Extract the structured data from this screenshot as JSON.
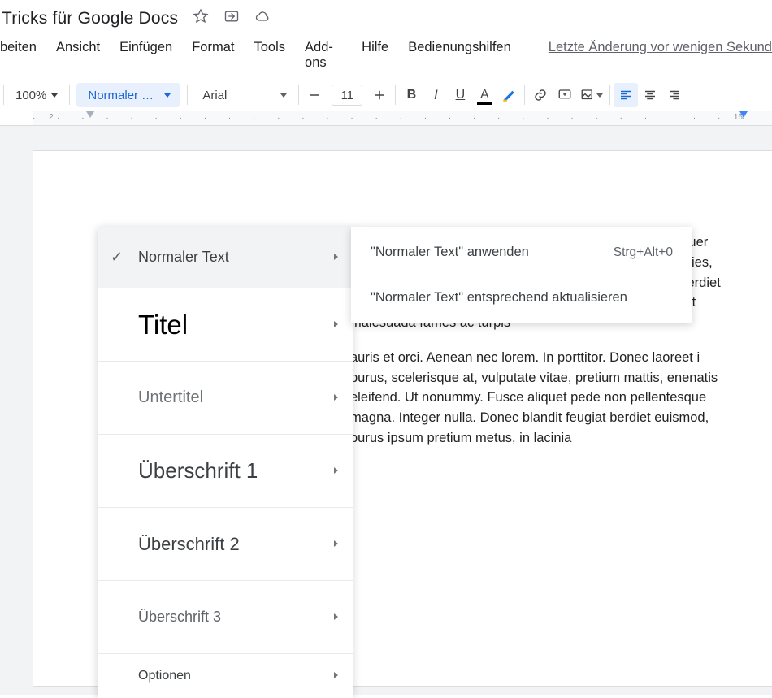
{
  "titlebar": {
    "doc_title": "Tricks für Google Docs"
  },
  "menubar": {
    "items": [
      "beiten",
      "Ansicht",
      "Einfügen",
      "Format",
      "Tools",
      "Add-ons",
      "Hilfe",
      "Bedienungshilfen"
    ],
    "last_change": "Letzte Änderung vor wenigen Sekund"
  },
  "toolbar": {
    "zoom": "100%",
    "style_label": "Normaler T...",
    "font_label": "Arial",
    "font_size": "11"
  },
  "ruler": {
    "num_left": "2",
    "num_right": "16"
  },
  "style_menu": {
    "items": [
      {
        "label": "Normaler Text",
        "checked": true,
        "cls": "smi-normal",
        "highlight": true,
        "height": "small"
      },
      {
        "label": "Titel",
        "checked": false,
        "cls": "smi-titel"
      },
      {
        "label": "Untertitel",
        "checked": false,
        "cls": "smi-untertitel"
      },
      {
        "label": "Überschrift 1",
        "checked": false,
        "cls": "smi-h1"
      },
      {
        "label": "Überschrift 2",
        "checked": false,
        "cls": "smi-h2"
      },
      {
        "label": "Überschrift 3",
        "checked": false,
        "cls": "smi-h3"
      },
      {
        "label": "Optionen",
        "checked": false,
        "cls": "smi-options",
        "options": true
      }
    ]
  },
  "sub_menu": {
    "apply_label": "\"Normaler Text\" anwenden",
    "apply_shortcut": "Strg+Alt+0",
    "update_label": "\"Normaler Text\" entsprechend aktualisieren"
  },
  "document": {
    "p1": "Veranschaulichung der Funktionen in Google Docs. ectetuer adipiscing elit. Maecenas porttitor congue massa. ar ultricies, purus lectus malesuada libero, sit amet Nunc viverra imperdiet enim. Fusce est. Vivamus a tellus. ue senectus et netus et malesuada fames ac turpis",
    "p2": "auris et orci. Aenean nec lorem. In porttitor. Donec laoreet i purus, scelerisque at, vulputate vitae, pretium mattis, enenatis eleifend. Ut nonummy. Fusce aliquet pede non pellentesque magna. Integer nulla. Donec blandit feugiat berdiet euismod, purus ipsum pretium metus, in lacinia"
  }
}
